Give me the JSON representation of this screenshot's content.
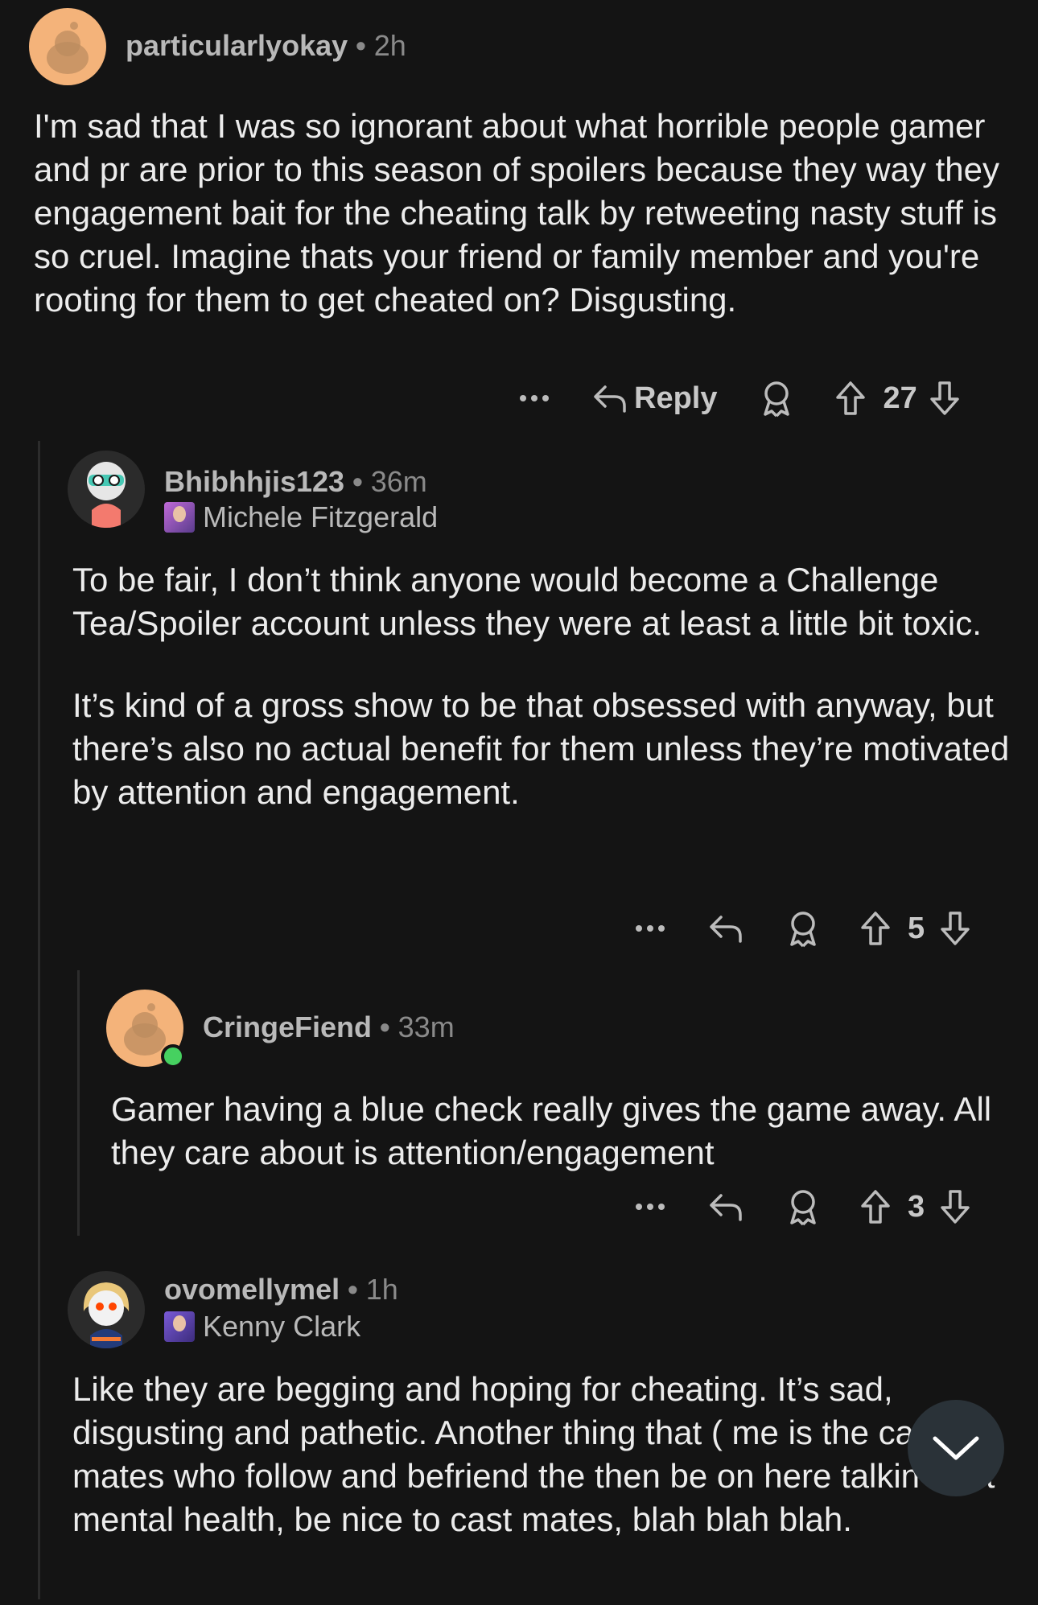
{
  "comments": [
    {
      "username": "particularlyokay",
      "time": "2h",
      "text": [
        "I'm sad that I was so ignorant about what horrible people gamer and pr are prior to this season of spoilers because they way they engagement bait for the cheating talk by retweeting nasty stuff is so cruel. Imagine thats your friend or family member and you're rooting for them to get cheated on? Disgusting."
      ],
      "reply_label": "Reply",
      "score": "27"
    },
    {
      "username": "Bhibhhjis123",
      "time": "36m",
      "flair": "Michele Fitzgerald",
      "text": [
        "To be fair, I don’t think anyone would become a Challenge Tea/Spoiler account unless they were at least a little bit toxic.",
        "It’s kind of a gross show to be that obsessed with anyway, but there’s also no actual benefit for them unless they’re motivated by attention and engagement."
      ],
      "score": "5"
    },
    {
      "username": "CringeFiend",
      "time": "33m",
      "text": [
        "Gamer having a blue check really gives the game away. All they care about is attention/engagement"
      ],
      "score": "3"
    },
    {
      "username": "ovomellymel",
      "time": "1h",
      "flair": "Kenny Clark",
      "text": [
        "Like they are begging and hoping for cheating. It’s sad, disgusting and pathetic. Another thing that ( me is the cast mates who follow and befriend the then be on here talkin bout mental health, be nice to cast mates, blah blah blah."
      ]
    }
  ],
  "separator": "•",
  "icons": {
    "more": "more-dots-icon",
    "reply": "reply-arrow-icon",
    "award": "award-icon",
    "upvote": "upvote-arrow-icon",
    "downvote": "downvote-arrow-icon",
    "scroll": "chevron-down-icon"
  },
  "colors": {
    "background": "#141414",
    "online": "#46d160",
    "fab": "#2a3238"
  }
}
